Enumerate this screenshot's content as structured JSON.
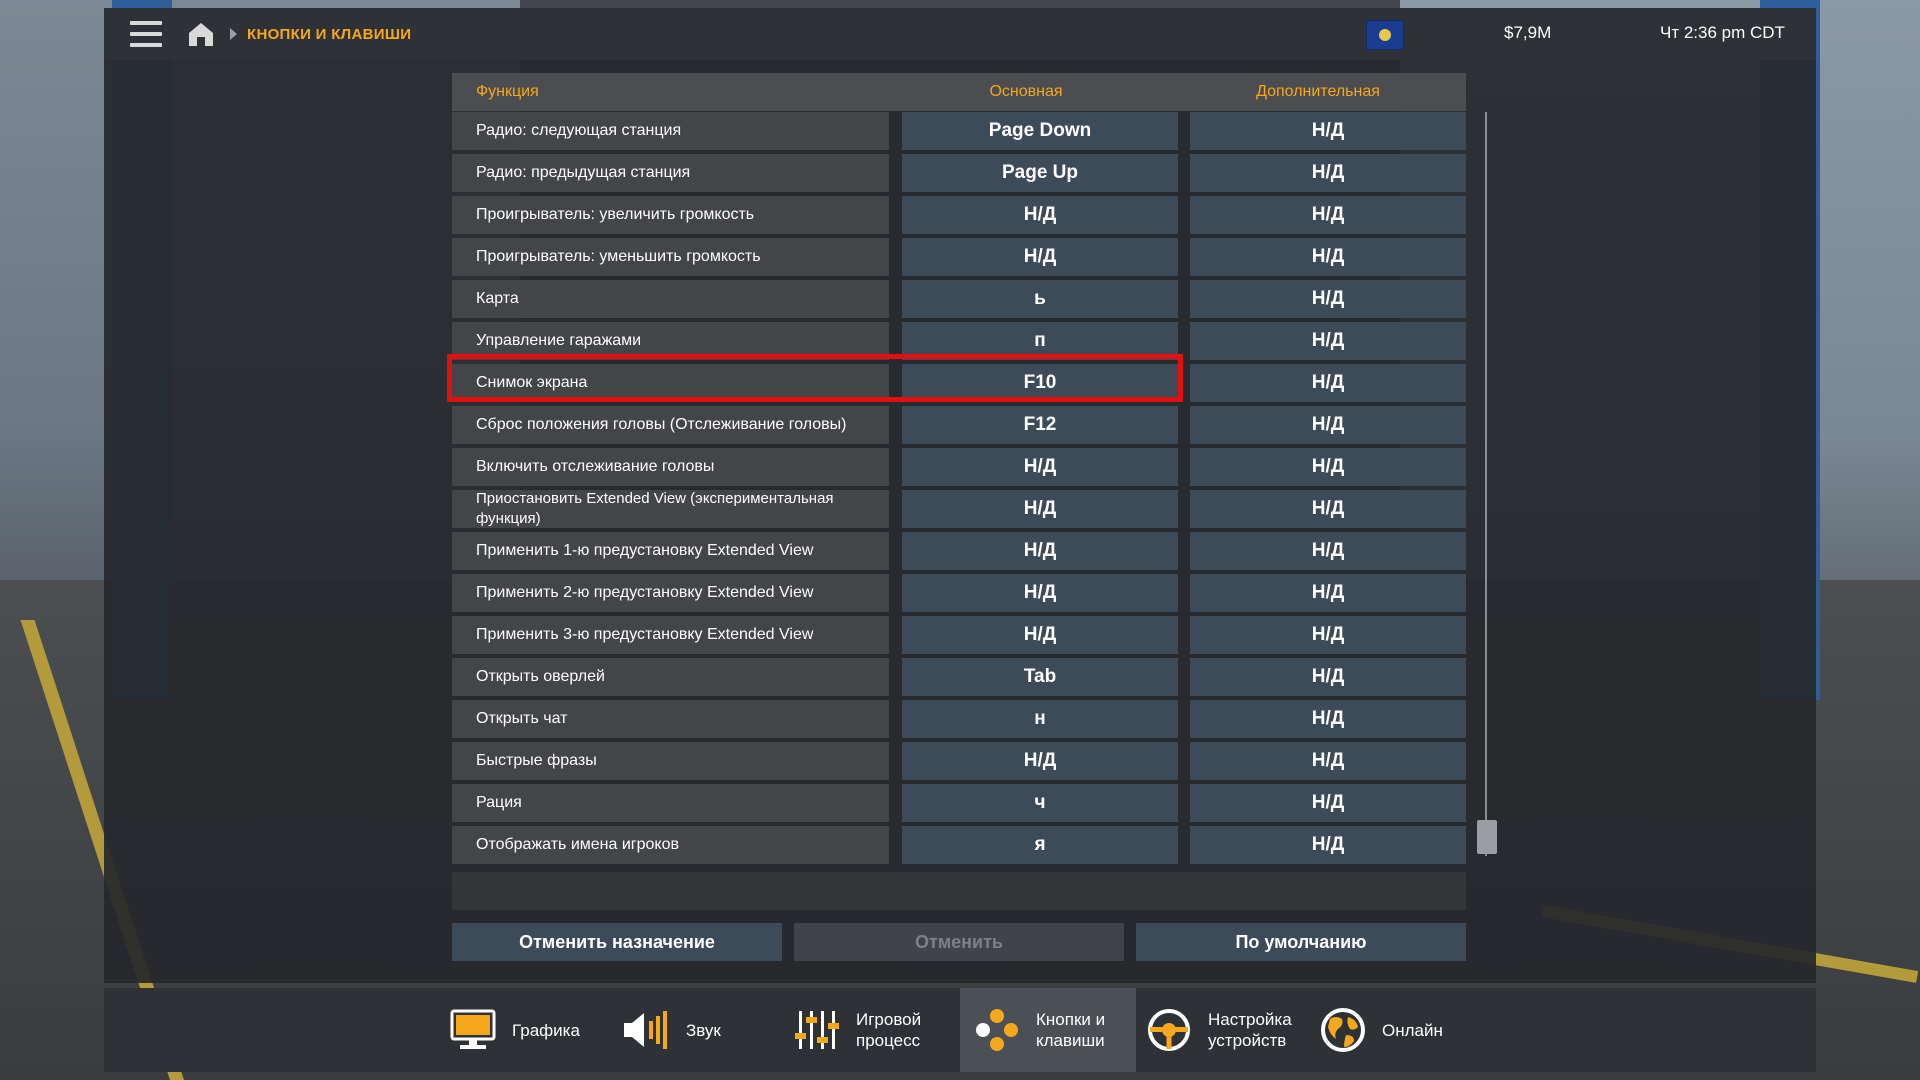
{
  "topbar": {
    "breadcrumb": "КНОПКИ И КЛАВИШИ",
    "money": "$7,9M",
    "clock": "Чт 2:36 pm CDT"
  },
  "table": {
    "headers": {
      "function": "Функция",
      "primary": "Основная",
      "secondary": "Дополнительная"
    },
    "rows": [
      {
        "function": "Радио: следующая станция",
        "primary": "Page Down",
        "secondary": "Н/Д"
      },
      {
        "function": "Радио: предыдущая станция",
        "primary": "Page Up",
        "secondary": "Н/Д"
      },
      {
        "function": "Проигрыватель: увеличить громкость",
        "primary": "Н/Д",
        "secondary": "Н/Д"
      },
      {
        "function": "Проигрыватель: уменьшить громкость",
        "primary": "Н/Д",
        "secondary": "Н/Д"
      },
      {
        "function": "Карта",
        "primary": "ь",
        "secondary": "Н/Д"
      },
      {
        "function": "Управление гаражами",
        "primary": "п",
        "secondary": "Н/Д"
      },
      {
        "function": "Снимок экрана",
        "primary": "F10",
        "secondary": "Н/Д"
      },
      {
        "function": "Сброс положения головы (Отслеживание головы)",
        "primary": "F12",
        "secondary": "Н/Д"
      },
      {
        "function": "Включить отслеживание головы",
        "primary": "Н/Д",
        "secondary": "Н/Д"
      },
      {
        "function": "Приостановить Extended View (экспериментальная функция)",
        "primary": "Н/Д",
        "secondary": "Н/Д"
      },
      {
        "function": "Применить 1-ю предустановку Extended View",
        "primary": "Н/Д",
        "secondary": "Н/Д"
      },
      {
        "function": "Применить 2-ю предустановку Extended View",
        "primary": "Н/Д",
        "secondary": "Н/Д"
      },
      {
        "function": "Применить 3-ю предустановку Extended View",
        "primary": "Н/Д",
        "secondary": "Н/Д"
      },
      {
        "function": "Открыть оверлей",
        "primary": "Tab",
        "secondary": "Н/Д"
      },
      {
        "function": "Открыть чат",
        "primary": "н",
        "secondary": "Н/Д"
      },
      {
        "function": "Быстрые фразы",
        "primary": "Н/Д",
        "secondary": "Н/Д"
      },
      {
        "function": "Рация",
        "primary": "ч",
        "secondary": "Н/Д"
      },
      {
        "function": "Отображать имена игроков",
        "primary": "я",
        "secondary": "Н/Д"
      }
    ]
  },
  "highlighted_row": 6,
  "buttons": {
    "unassign": "Отменить назначение",
    "cancel": "Отменить",
    "defaults": "По умолчанию"
  },
  "nav": {
    "graphics": "Графика",
    "sound": "Звук",
    "gameplay_line1": "Игровой",
    "gameplay_line2": "процесс",
    "keys_line1": "Кнопки и",
    "keys_line2": "клавиши",
    "devices_line1": "Настройка",
    "devices_line2": "устройств",
    "online": "Онлайн"
  },
  "colors": {
    "accent": "#f5a81b",
    "key_button": "#3d4a58",
    "highlight": "#e20f0f"
  }
}
